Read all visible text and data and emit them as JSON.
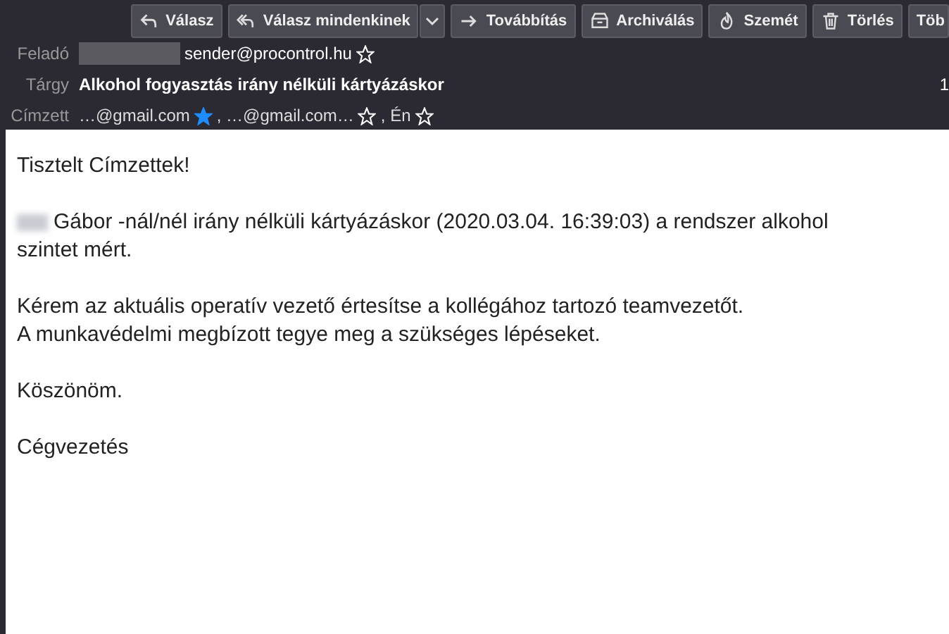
{
  "toolbar": {
    "buttons": [
      {
        "label": "Válasz",
        "kind": "reply"
      },
      {
        "label": "Válasz mindenkinek",
        "kind": "reply-all"
      },
      {
        "label": "Továbbítás",
        "kind": "forward"
      },
      {
        "label": "Archiválás",
        "kind": "archive"
      },
      {
        "label": "Szemét",
        "kind": "junk"
      },
      {
        "label": "Törlés",
        "kind": "delete"
      },
      {
        "label": "Töb",
        "kind": "more"
      }
    ]
  },
  "header": {
    "from_label": "Feladó",
    "from": "sender@procontrol.hu",
    "from_starred": false,
    "subject_label": "Tárgy",
    "subject": "Alkohol fogyasztás irány nélküli kártyázáskor",
    "date": "1",
    "to_label": "Címzett",
    "recipients": [
      {
        "text": "…@gmail.com",
        "starred": true
      },
      {
        "text": ", …@gmail.com…",
        "starred": false
      },
      {
        "text": ", Én",
        "starred": false
      }
    ]
  },
  "body": {
    "paragraphs": [
      {
        "lines": [
          "Tisztelt Címzettek!"
        ],
        "redacted_name": false
      },
      {
        "lines": [
          "Gábor -nál/nél irány nélküli kártyázáskor (2020.03.04. 16:39:03) a rendszer alkohol szintet mért."
        ],
        "redacted_name": true
      },
      {
        "lines": [
          "Kérem az aktuális operatív vezető értesítse a kollégához tartozó teamvezetőt.",
          "A munkavédelmi megbízott tegye meg a szükséges lépéseket."
        ],
        "redacted_name": false
      },
      {
        "lines": [
          "Köszönöm."
        ],
        "redacted_name": false
      },
      {
        "lines": [
          "Cégvezetés"
        ],
        "redacted_name": false
      }
    ]
  }
}
